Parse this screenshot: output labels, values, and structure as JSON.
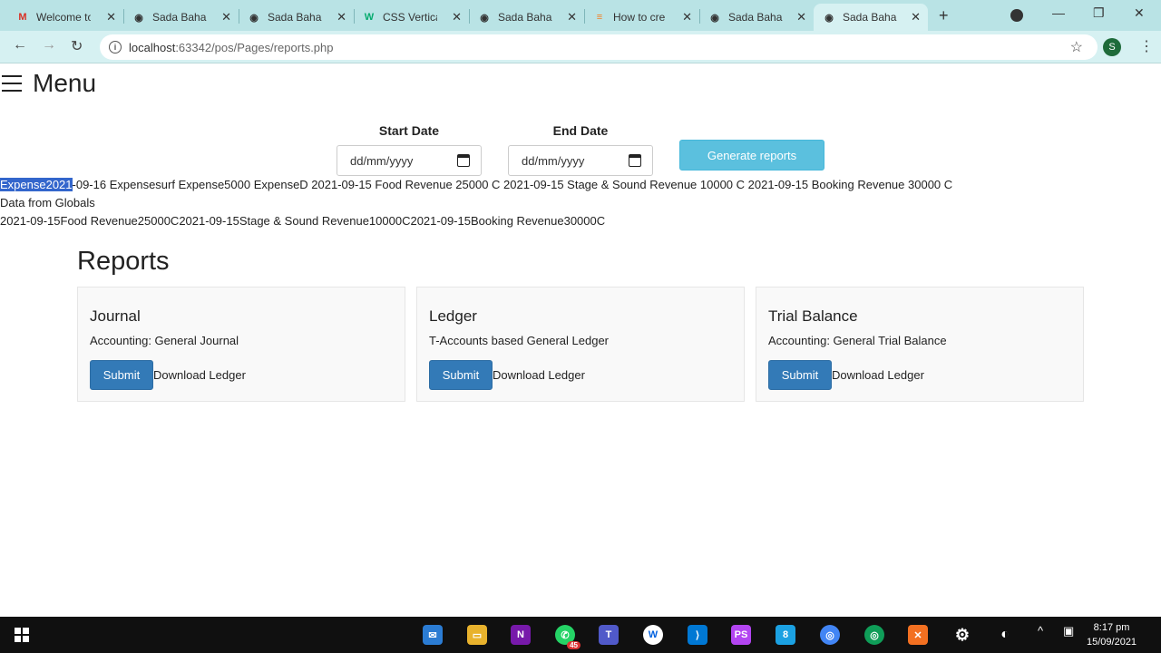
{
  "browser": {
    "tabs": [
      {
        "title": "Welcome to",
        "icon": "gmail-icon",
        "active": false
      },
      {
        "title": "Sada Bahar",
        "icon": "globe-icon",
        "active": false
      },
      {
        "title": "Sada Bahar",
        "icon": "globe-icon",
        "active": false
      },
      {
        "title": "CSS Vertical",
        "icon": "w3schools-icon",
        "active": false
      },
      {
        "title": "Sada Bahar",
        "icon": "globe-icon",
        "active": false
      },
      {
        "title": "How to cre",
        "icon": "stackoverflow-icon",
        "active": false
      },
      {
        "title": "Sada Bahar",
        "icon": "globe-icon",
        "active": false
      },
      {
        "title": "Sada Bahar",
        "icon": "globe-icon",
        "active": true
      }
    ],
    "url_host": "localhost",
    "url_path": ":63342/pos/Pages/reports.php",
    "profile_initial": "S"
  },
  "page": {
    "menu_label": "Menu",
    "start_date_label": "Start Date",
    "end_date_label": "End Date",
    "start_date_placeholder": "dd/mm/yyyy",
    "end_date_placeholder": "dd/mm/yyyy",
    "generate_button": "Generate reports",
    "raw_output": {
      "line1_highlighted": "Expense2021",
      "line1_rest": "-09-16 Expensesurf Expense5000 ExpenseD 2021-09-15 Food Revenue 25000 C 2021-09-15 Stage & Sound Revenue 10000 C 2021-09-15 Booking Revenue 30000 C",
      "line2": "Data from Globals",
      "line3": "2021-09-15Food Revenue25000C2021-09-15Stage & Sound Revenue10000C2021-09-15Booking Revenue30000C"
    },
    "reports_heading": "Reports",
    "cards": [
      {
        "title": "Journal",
        "description": "Accounting: General Journal",
        "submit": "Submit",
        "download": "Download Ledger"
      },
      {
        "title": "Ledger",
        "description": "T-Accounts based General Ledger",
        "submit": "Submit",
        "download": "Download Ledger"
      },
      {
        "title": "Trial Balance",
        "description": "Accounting: General Trial Balance",
        "submit": "Submit",
        "download": "Download Ledger"
      }
    ]
  },
  "taskbar": {
    "time": "8:17 pm",
    "date": "15/09/2021",
    "whatsapp_badge": "45"
  },
  "colors": {
    "tabstrip": "#b9e3e5",
    "generate_button": "#5bc0de",
    "submit_button": "#337ab7",
    "selection": "#3366cc"
  }
}
